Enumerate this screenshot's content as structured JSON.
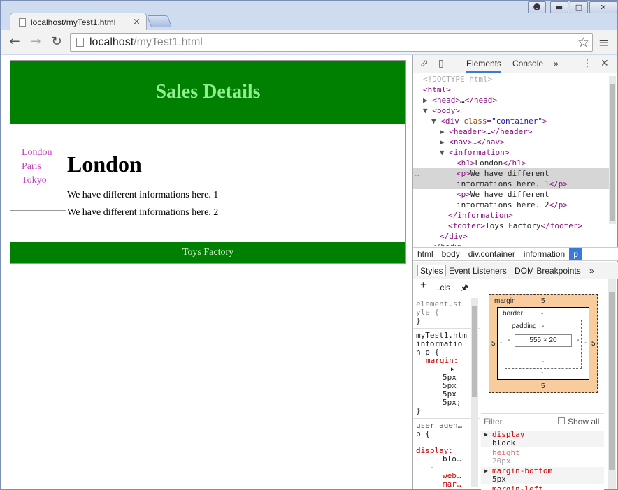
{
  "window": {
    "controls": [
      "user-icon",
      "minimize-icon",
      "maximize-icon",
      "close-icon"
    ]
  },
  "tab": {
    "title": "localhost/myTest1.html",
    "close": "×"
  },
  "toolbar": {
    "back": "←",
    "forward": "→",
    "reload": "↻",
    "url_host": "localhost",
    "url_path": "/myTest1.html",
    "star": "☆",
    "menu": "≡"
  },
  "page": {
    "header_title": "Sales Details",
    "nav_links": [
      "London",
      "Paris",
      "Tokyo"
    ],
    "heading": "London",
    "paragraphs": [
      "We have different informations here. 1",
      "We have different informations here. 2"
    ],
    "footer": "Toys Factory",
    "colors": {
      "header_bg": "#008000",
      "header_text": "#90ee90",
      "link": "#c040c0"
    }
  },
  "devtools": {
    "tabs": {
      "elements": "Elements",
      "console": "Console",
      "more": "»"
    },
    "dom": {
      "doctype": "<!DOCTYPE html>",
      "html_open": "html",
      "head": "head",
      "head_ellipsis": "…",
      "body": "body",
      "div_tag": "div",
      "div_attr": "class",
      "div_val": "\"container\"",
      "header": "header",
      "nav": "nav",
      "information": "information",
      "h1_text": "London",
      "p1_text_a": "We have different",
      "p1_text_b": "informations here. 1",
      "p2_text_a": "We have different",
      "p2_text_b": "informations here. 2",
      "footer_text": "Toys Factory",
      "selected_marker": "…"
    },
    "breadcrumbs": [
      "html",
      "body",
      "div.container",
      "information",
      "p"
    ],
    "styles_tabs": {
      "styles": "Styles",
      "event_listeners": "Event Listeners",
      "dom_breakpoints": "DOM Breakpoints",
      "more": "»"
    },
    "styles_toolbar": {
      "add": "+",
      "cls": ".cls"
    },
    "styles": {
      "element_style_a": "element.st",
      "element_style_b": "yle {",
      "close_brace": "}",
      "source_link": "myTest1.htm",
      "selector_a": "informatio",
      "selector_b": "n p {",
      "margin_prop": "margin:",
      "margin_vals": [
        "5px",
        "5px",
        "5px",
        "5px;"
      ],
      "ua_label": "user agen…",
      "ua_selector": "p {",
      "display_prop": "display:",
      "display_val": "blo…",
      "webkit_dash": "-",
      "webkit_prop": "web…",
      "more_prop": "mar…"
    },
    "box_model": {
      "margin_label": "margin",
      "margin_top": "5",
      "margin_bottom": "5",
      "margin_left": "5",
      "margin_right": "5",
      "border_label": "border",
      "border_top": "-",
      "border_bottom": "-",
      "border_left": "-",
      "border_right": "-",
      "padding_label": "padding",
      "padding_top": "-",
      "padding_bottom": "-",
      "padding_left": "-",
      "padding_right": "-",
      "content": "555 × 20"
    },
    "filter": {
      "placeholder": "Filter",
      "show_all": "Show all"
    },
    "computed": [
      {
        "prop": "display",
        "value": "block",
        "inherited": false
      },
      {
        "prop": "height",
        "value": "20px",
        "inherited": true
      },
      {
        "prop": "margin-bottom",
        "value": "5px",
        "inherited": false
      },
      {
        "prop": "margin-left",
        "value": "",
        "inherited": false
      }
    ]
  }
}
